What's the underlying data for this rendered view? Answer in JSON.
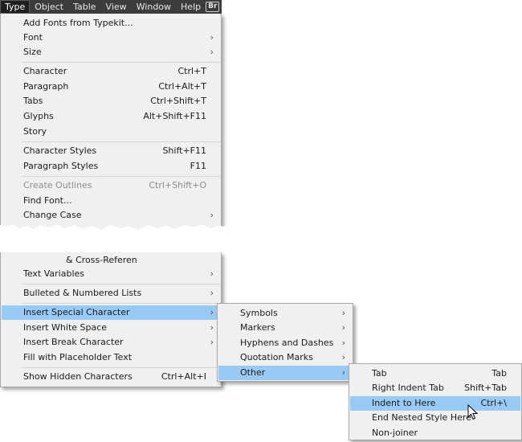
{
  "menubar": {
    "items": [
      "Type",
      "Object",
      "Table",
      "View",
      "Window",
      "Help"
    ],
    "badge": "Br"
  },
  "type_menu_top": [
    {
      "label": "Add Fonts from Typekit...",
      "shortcut": "",
      "arrow": false
    },
    {
      "label": "Font",
      "shortcut": "",
      "arrow": true
    },
    {
      "label": "Size",
      "shortcut": "",
      "arrow": true
    },
    {
      "label": "Character",
      "shortcut": "Ctrl+T",
      "arrow": false
    },
    {
      "label": "Paragraph",
      "shortcut": "Ctrl+Alt+T",
      "arrow": false
    },
    {
      "label": "Tabs",
      "shortcut": "Ctrl+Shift+T",
      "arrow": false
    },
    {
      "label": "Glyphs",
      "shortcut": "Alt+Shift+F11",
      "arrow": false
    },
    {
      "label": "Story",
      "shortcut": "",
      "arrow": false
    },
    {
      "label": "Character Styles",
      "shortcut": "Shift+F11",
      "arrow": false
    },
    {
      "label": "Paragraph Styles",
      "shortcut": "F11",
      "arrow": false
    },
    {
      "label": "Create Outlines",
      "shortcut": "Ctrl+Shift+O",
      "arrow": false,
      "disabled": true
    },
    {
      "label": "Find Font...",
      "shortcut": "",
      "arrow": false
    },
    {
      "label": "Change Case",
      "shortcut": "",
      "arrow": true
    }
  ],
  "type_menu_bottom": [
    {
      "label": "& Cross-Referen",
      "shortcut": "",
      "arrow": false,
      "partial": true
    },
    {
      "label": "Text Variables",
      "shortcut": "",
      "arrow": true
    },
    {
      "label": "Bulleted & Numbered Lists",
      "shortcut": "",
      "arrow": true
    },
    {
      "label": "Insert Special Character",
      "shortcut": "",
      "arrow": true,
      "highlighted": true
    },
    {
      "label": "Insert White Space",
      "shortcut": "",
      "arrow": true
    },
    {
      "label": "Insert Break Character",
      "shortcut": "",
      "arrow": true
    },
    {
      "label": "Fill with Placeholder Text",
      "shortcut": "",
      "arrow": false
    },
    {
      "label": "Show Hidden Characters",
      "shortcut": "Ctrl+Alt+I",
      "arrow": false
    }
  ],
  "special_char_menu": [
    {
      "label": "Symbols",
      "arrow": true
    },
    {
      "label": "Markers",
      "arrow": true
    },
    {
      "label": "Hyphens and Dashes",
      "arrow": true
    },
    {
      "label": "Quotation Marks",
      "arrow": true
    },
    {
      "label": "Other",
      "arrow": true,
      "highlighted": true
    }
  ],
  "other_menu": [
    {
      "label": "Tab",
      "shortcut": "Tab"
    },
    {
      "label": "Right Indent Tab",
      "shortcut": "Shift+Tab"
    },
    {
      "label": "Indent to Here",
      "shortcut": "Ctrl+\\",
      "highlighted": true
    },
    {
      "label": "End Nested Style Here",
      "shortcut": ""
    },
    {
      "label": "Non-joiner",
      "shortcut": ""
    }
  ],
  "colors": {
    "highlight": "#99c9f5",
    "menu_bg": "#f0f0f0",
    "menubar_bg": "#3c3c3c"
  }
}
